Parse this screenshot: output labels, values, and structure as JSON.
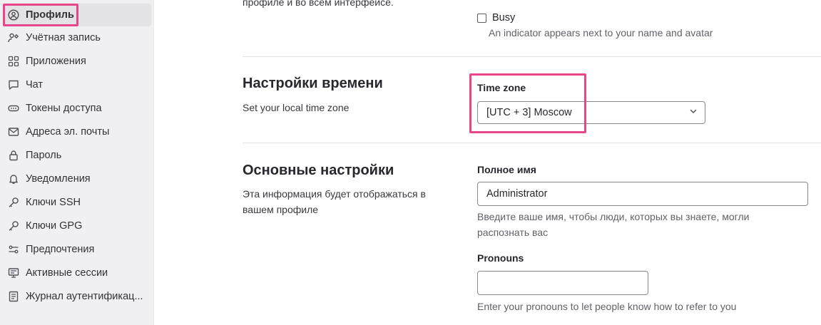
{
  "sidebar": {
    "items": [
      {
        "label": "Профиль",
        "icon": "user-circle-icon",
        "active": true
      },
      {
        "label": "Учётная запись",
        "icon": "user-settings-icon"
      },
      {
        "label": "Приложения",
        "icon": "applications-icon"
      },
      {
        "label": "Чат",
        "icon": "chat-icon"
      },
      {
        "label": "Токены доступа",
        "icon": "token-icon"
      },
      {
        "label": "Адреса эл. почты",
        "icon": "mail-icon"
      },
      {
        "label": "Пароль",
        "icon": "lock-icon"
      },
      {
        "label": "Уведомления",
        "icon": "bell-icon"
      },
      {
        "label": "Ключи SSH",
        "icon": "key-icon"
      },
      {
        "label": "Ключи GPG",
        "icon": "key-icon"
      },
      {
        "label": "Предпочтения",
        "icon": "preferences-icon"
      },
      {
        "label": "Активные сессии",
        "icon": "monitor-icon"
      },
      {
        "label": "Журнал аутентификац...",
        "icon": "log-icon"
      }
    ]
  },
  "status": {
    "partial_text": "профиле и во всем интерфейсе.",
    "busy_label": "Busy",
    "busy_checked": false,
    "busy_help": "An indicator appears next to your name and avatar"
  },
  "time_settings": {
    "title": "Настройки времени",
    "description": "Set your local time zone",
    "timezone_label": "Time zone",
    "timezone_value": "[UTC + 3] Moscow"
  },
  "main_settings": {
    "title": "Основные настройки",
    "description_line1": "Эта информация будет отображаться в",
    "description_line2": "вашем профиле",
    "fullname_label": "Полное имя",
    "fullname_value": "Administrator",
    "fullname_help_line1": "Введите ваше имя, чтобы люди, которых вы знаете, могли",
    "fullname_help_line2": "распознать вас",
    "pronouns_label": "Pronouns",
    "pronouns_value": "",
    "pronouns_help": "Enter your pronouns to let people know how to refer to you"
  },
  "colors": {
    "highlight": "#e8458b",
    "sidebar_bg": "#f0f0f2"
  }
}
